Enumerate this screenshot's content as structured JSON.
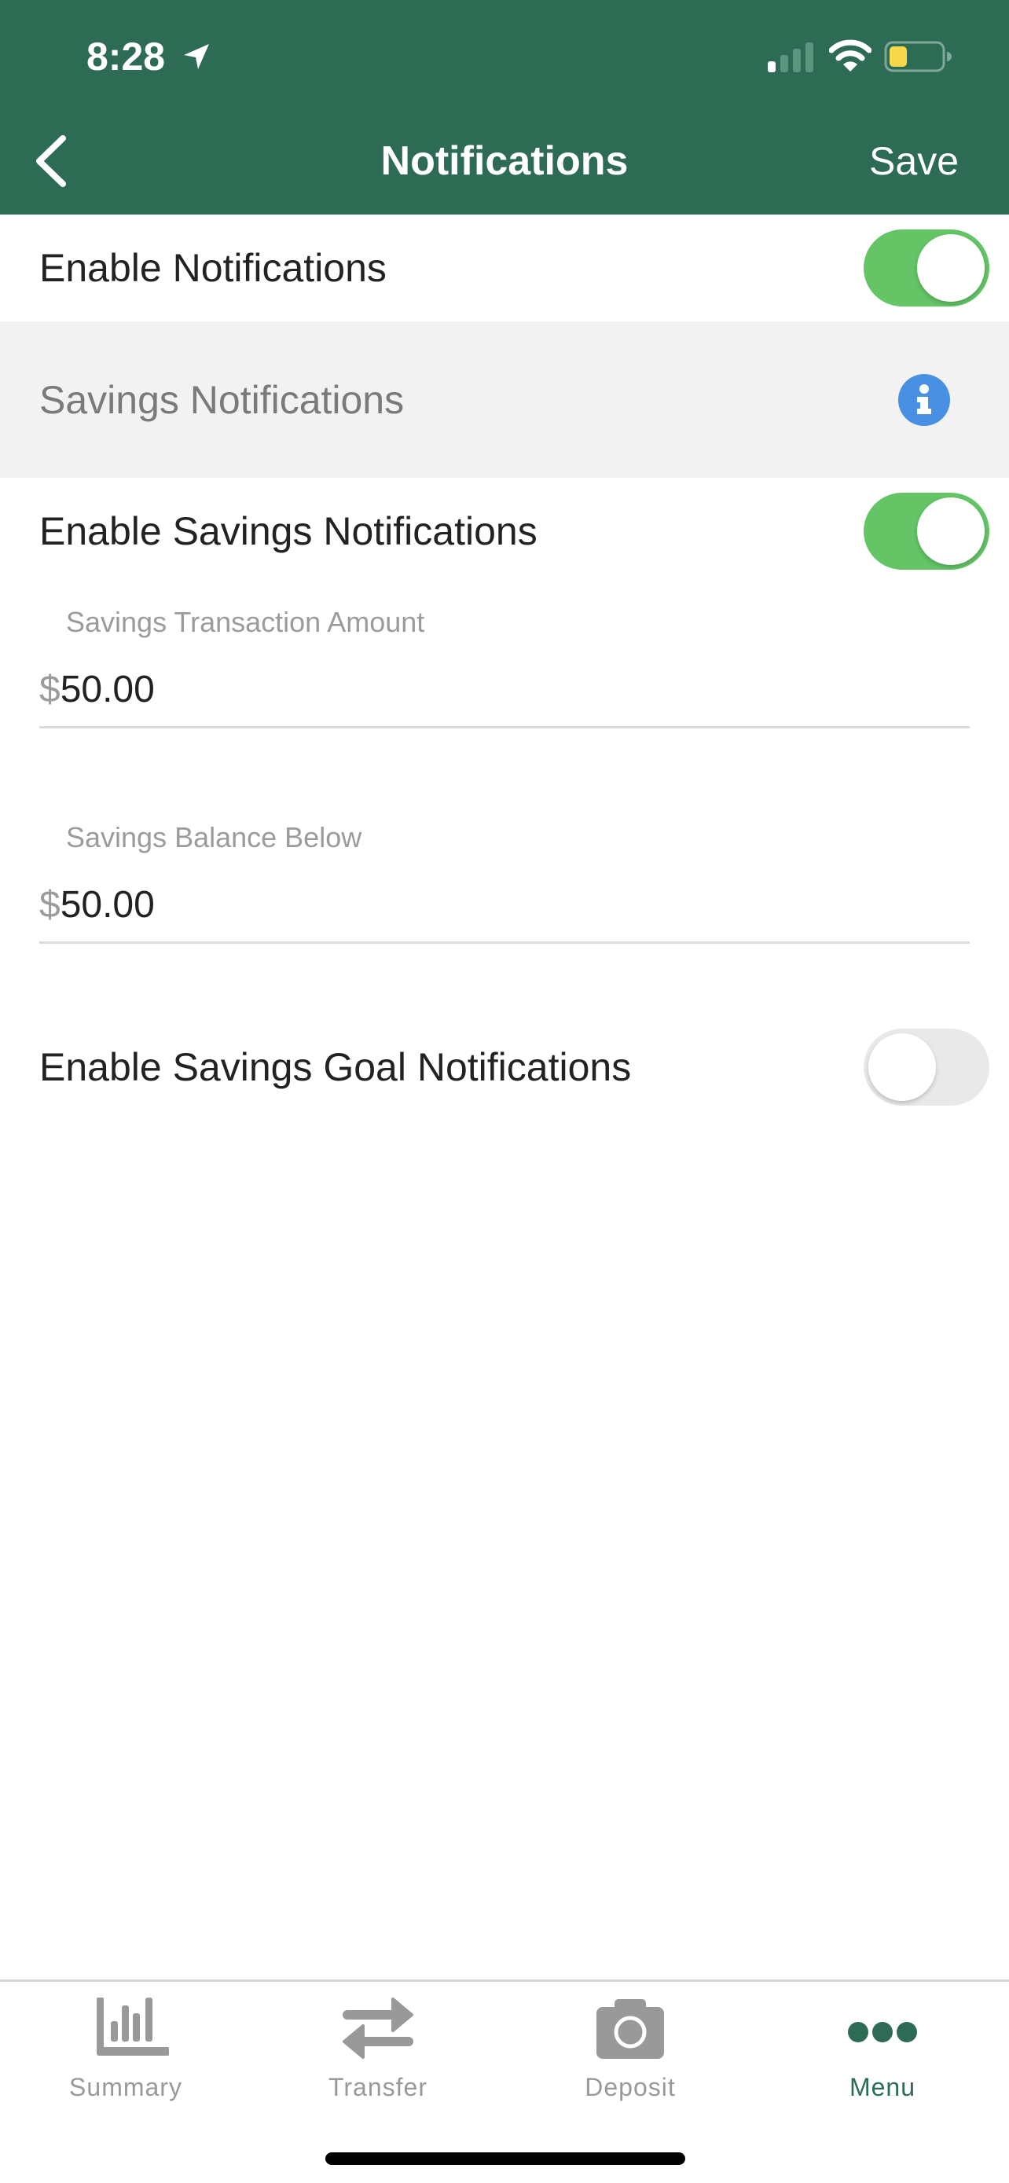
{
  "status_bar": {
    "time": "8:28",
    "icons": [
      "location-arrow-icon",
      "cellular-signal-icon",
      "wifi-icon",
      "battery-icon"
    ],
    "signal_bars_active": 1,
    "signal_bars_total": 4,
    "battery_level_percent": 25,
    "battery_color": "#f7d84a"
  },
  "header": {
    "title": "Notifications",
    "back_icon": "chevron-left-icon",
    "save_label": "Save",
    "background_color": "#2e6b55"
  },
  "settings": {
    "enable_notifications": {
      "label": "Enable Notifications",
      "enabled": true
    },
    "savings_section": {
      "title": "Savings Notifications",
      "info_icon": "info-icon"
    },
    "enable_savings_notifications": {
      "label": "Enable Savings Notifications",
      "enabled": true
    },
    "savings_transaction_amount": {
      "label": "Savings Transaction Amount",
      "currency": "$",
      "value": "50.00"
    },
    "savings_balance_below": {
      "label": "Savings Balance Below",
      "currency": "$",
      "value": "50.00"
    },
    "enable_savings_goal_notifications": {
      "label": "Enable Savings Goal Notifications",
      "enabled": false
    }
  },
  "colors": {
    "toggle_on": "#64c466",
    "toggle_off": "#e9e9ea",
    "info_blue": "#4a90e2",
    "section_bg": "#f2f2f2",
    "tab_inactive": "#999999",
    "tab_active": "#2e6b55"
  },
  "tabbar": {
    "tabs": [
      {
        "label": "Summary",
        "icon": "bar-chart-icon",
        "active": false
      },
      {
        "label": "Transfer",
        "icon": "transfer-arrows-icon",
        "active": false
      },
      {
        "label": "Deposit",
        "icon": "camera-icon",
        "active": false
      },
      {
        "label": "Menu",
        "icon": "more-dots-icon",
        "active": true
      }
    ]
  }
}
